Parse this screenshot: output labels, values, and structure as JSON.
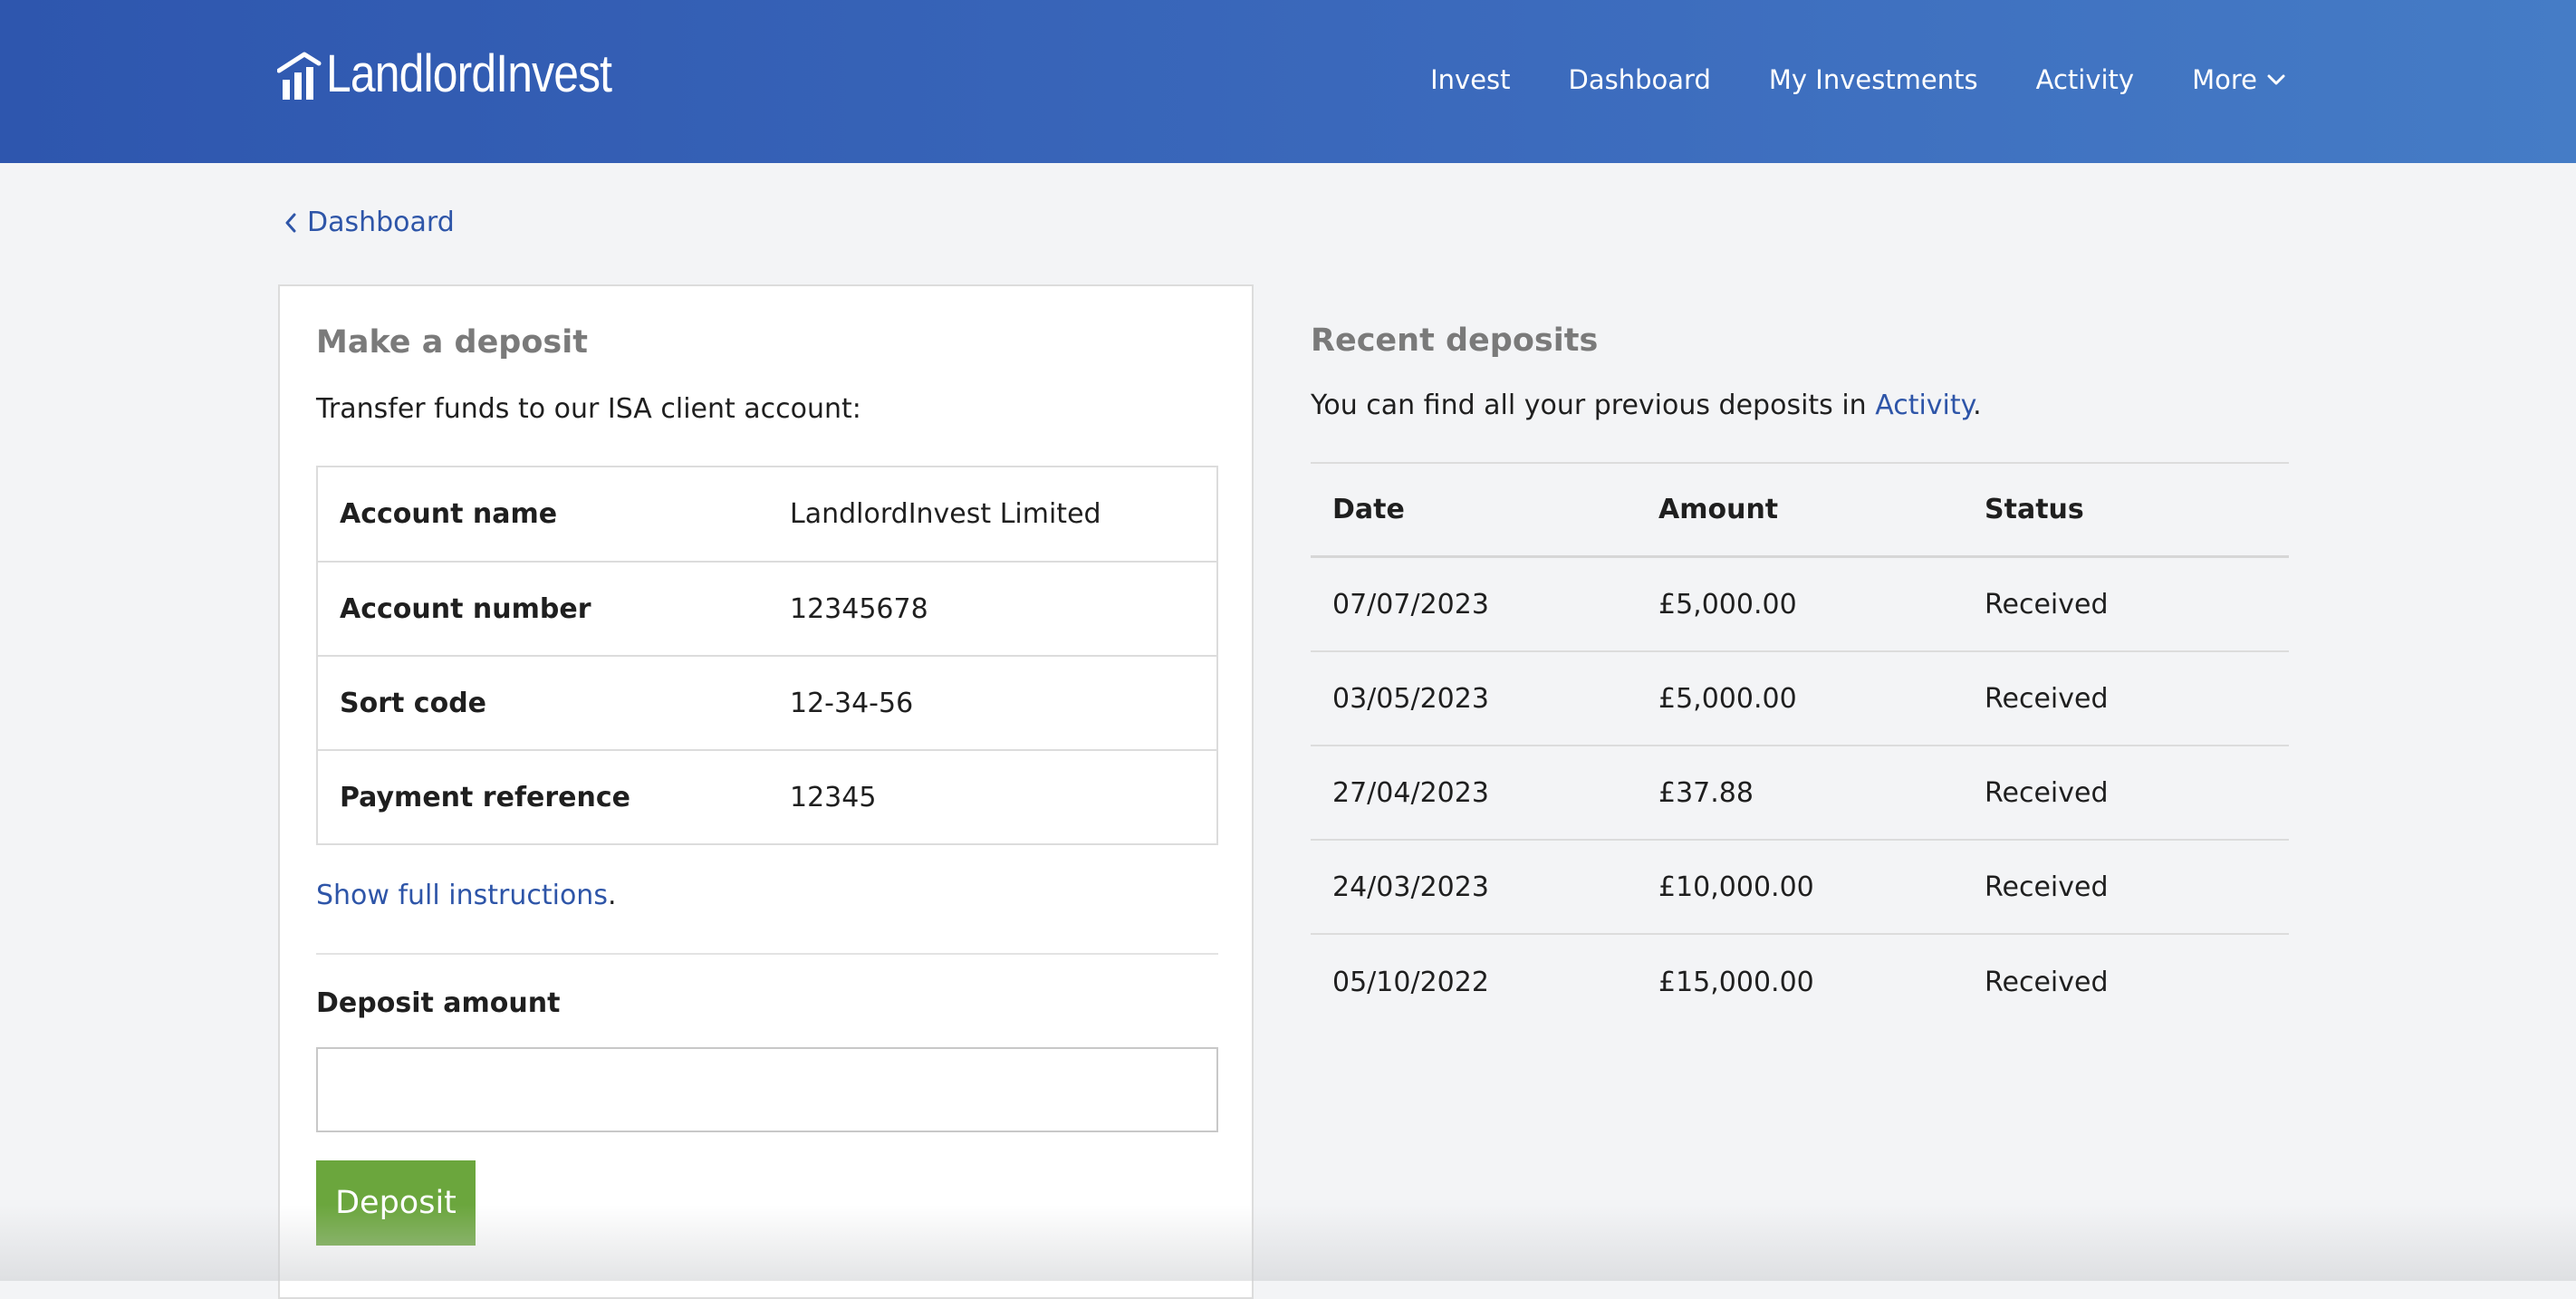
{
  "header": {
    "logo_text": "LandlordInvest",
    "logo_icon": "bar-chart-roof-icon",
    "nav": [
      {
        "label": "Invest"
      },
      {
        "label": "Dashboard"
      },
      {
        "label": "My Investments"
      },
      {
        "label": "Activity"
      },
      {
        "label": "More",
        "icon": "chevron-down-icon"
      }
    ]
  },
  "breadcrumb": {
    "label": "Dashboard",
    "icon": "chevron-left-icon"
  },
  "deposit": {
    "title": "Make a deposit",
    "intro": "Transfer funds to our ISA client account:",
    "account_rows": [
      {
        "label": "Account name",
        "value": "LandlordInvest Limited"
      },
      {
        "label": "Account number",
        "value": "12345678"
      },
      {
        "label": "Sort code",
        "value": "12-34-56"
      },
      {
        "label": "Payment reference",
        "value": "12345"
      }
    ],
    "instructions_link": "Show full instructions",
    "instructions_suffix": ".",
    "amount_label": "Deposit amount",
    "amount_value": "",
    "button_label": "Deposit"
  },
  "recent": {
    "title": "Recent deposits",
    "intro_prefix": "You can find all your previous deposits in ",
    "intro_link": "Activity",
    "intro_suffix": ".",
    "columns": {
      "date": "Date",
      "amount": "Amount",
      "status": "Status"
    },
    "rows": [
      {
        "date": "07/07/2023",
        "amount": "£5,000.00",
        "status": "Received"
      },
      {
        "date": "03/05/2023",
        "amount": "£5,000.00",
        "status": "Received"
      },
      {
        "date": "27/04/2023",
        "amount": "£37.88",
        "status": "Received"
      },
      {
        "date": "24/03/2023",
        "amount": "£10,000.00",
        "status": "Received"
      },
      {
        "date": "05/10/2022",
        "amount": "£15,000.00",
        "status": "Received"
      }
    ]
  },
  "colors": {
    "header_start": "#2e56ae",
    "header_end": "#457cc6",
    "link": "#2e55a8",
    "button": "#6ba63d",
    "background": "#f3f4f6"
  }
}
